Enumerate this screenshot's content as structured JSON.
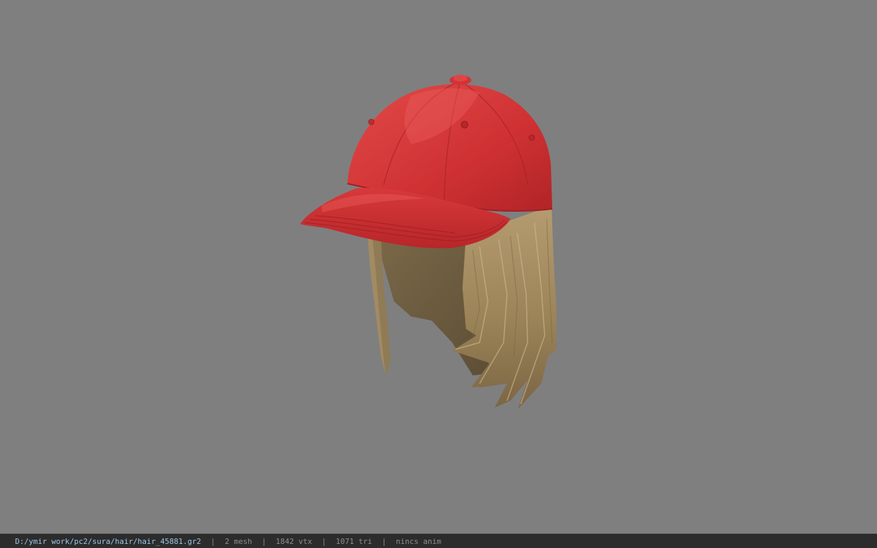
{
  "viewer": {
    "background_color": "#7f7f7f",
    "model_name": "hair_45881",
    "cap_color": "#d23436",
    "hair_color": "#a48a5e"
  },
  "statusbar": {
    "file_path": "D:/ymir work/pc2/sura/hair/hair_45881.gr2",
    "separator": "|",
    "mesh": "2 mesh",
    "vtx": "1842 vtx",
    "tri": "1071 tri",
    "anim": "nincs anim"
  }
}
